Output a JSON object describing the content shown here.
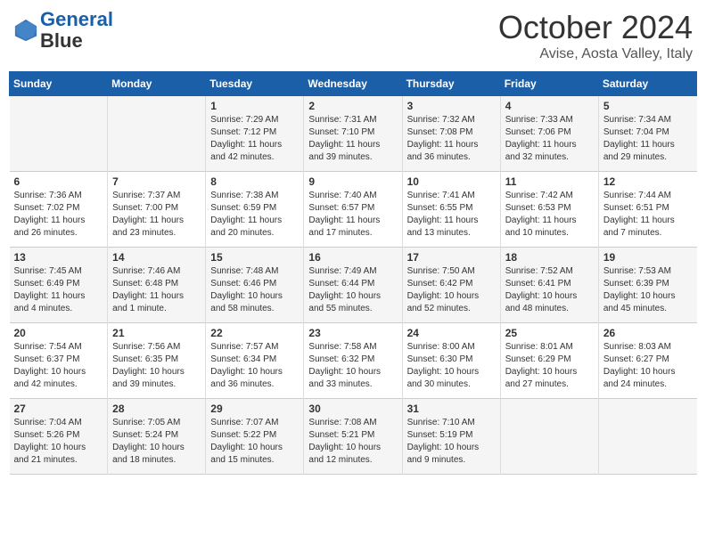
{
  "header": {
    "logo_line1": "General",
    "logo_line2": "Blue",
    "title": "October 2024",
    "subtitle": "Avise, Aosta Valley, Italy"
  },
  "days_of_week": [
    "Sunday",
    "Monday",
    "Tuesday",
    "Wednesday",
    "Thursday",
    "Friday",
    "Saturday"
  ],
  "weeks": [
    [
      {
        "day": "",
        "info": ""
      },
      {
        "day": "",
        "info": ""
      },
      {
        "day": "1",
        "info": "Sunrise: 7:29 AM\nSunset: 7:12 PM\nDaylight: 11 hours\nand 42 minutes."
      },
      {
        "day": "2",
        "info": "Sunrise: 7:31 AM\nSunset: 7:10 PM\nDaylight: 11 hours\nand 39 minutes."
      },
      {
        "day": "3",
        "info": "Sunrise: 7:32 AM\nSunset: 7:08 PM\nDaylight: 11 hours\nand 36 minutes."
      },
      {
        "day": "4",
        "info": "Sunrise: 7:33 AM\nSunset: 7:06 PM\nDaylight: 11 hours\nand 32 minutes."
      },
      {
        "day": "5",
        "info": "Sunrise: 7:34 AM\nSunset: 7:04 PM\nDaylight: 11 hours\nand 29 minutes."
      }
    ],
    [
      {
        "day": "6",
        "info": "Sunrise: 7:36 AM\nSunset: 7:02 PM\nDaylight: 11 hours\nand 26 minutes."
      },
      {
        "day": "7",
        "info": "Sunrise: 7:37 AM\nSunset: 7:00 PM\nDaylight: 11 hours\nand 23 minutes."
      },
      {
        "day": "8",
        "info": "Sunrise: 7:38 AM\nSunset: 6:59 PM\nDaylight: 11 hours\nand 20 minutes."
      },
      {
        "day": "9",
        "info": "Sunrise: 7:40 AM\nSunset: 6:57 PM\nDaylight: 11 hours\nand 17 minutes."
      },
      {
        "day": "10",
        "info": "Sunrise: 7:41 AM\nSunset: 6:55 PM\nDaylight: 11 hours\nand 13 minutes."
      },
      {
        "day": "11",
        "info": "Sunrise: 7:42 AM\nSunset: 6:53 PM\nDaylight: 11 hours\nand 10 minutes."
      },
      {
        "day": "12",
        "info": "Sunrise: 7:44 AM\nSunset: 6:51 PM\nDaylight: 11 hours\nand 7 minutes."
      }
    ],
    [
      {
        "day": "13",
        "info": "Sunrise: 7:45 AM\nSunset: 6:49 PM\nDaylight: 11 hours\nand 4 minutes."
      },
      {
        "day": "14",
        "info": "Sunrise: 7:46 AM\nSunset: 6:48 PM\nDaylight: 11 hours\nand 1 minute."
      },
      {
        "day": "15",
        "info": "Sunrise: 7:48 AM\nSunset: 6:46 PM\nDaylight: 10 hours\nand 58 minutes."
      },
      {
        "day": "16",
        "info": "Sunrise: 7:49 AM\nSunset: 6:44 PM\nDaylight: 10 hours\nand 55 minutes."
      },
      {
        "day": "17",
        "info": "Sunrise: 7:50 AM\nSunset: 6:42 PM\nDaylight: 10 hours\nand 52 minutes."
      },
      {
        "day": "18",
        "info": "Sunrise: 7:52 AM\nSunset: 6:41 PM\nDaylight: 10 hours\nand 48 minutes."
      },
      {
        "day": "19",
        "info": "Sunrise: 7:53 AM\nSunset: 6:39 PM\nDaylight: 10 hours\nand 45 minutes."
      }
    ],
    [
      {
        "day": "20",
        "info": "Sunrise: 7:54 AM\nSunset: 6:37 PM\nDaylight: 10 hours\nand 42 minutes."
      },
      {
        "day": "21",
        "info": "Sunrise: 7:56 AM\nSunset: 6:35 PM\nDaylight: 10 hours\nand 39 minutes."
      },
      {
        "day": "22",
        "info": "Sunrise: 7:57 AM\nSunset: 6:34 PM\nDaylight: 10 hours\nand 36 minutes."
      },
      {
        "day": "23",
        "info": "Sunrise: 7:58 AM\nSunset: 6:32 PM\nDaylight: 10 hours\nand 33 minutes."
      },
      {
        "day": "24",
        "info": "Sunrise: 8:00 AM\nSunset: 6:30 PM\nDaylight: 10 hours\nand 30 minutes."
      },
      {
        "day": "25",
        "info": "Sunrise: 8:01 AM\nSunset: 6:29 PM\nDaylight: 10 hours\nand 27 minutes."
      },
      {
        "day": "26",
        "info": "Sunrise: 8:03 AM\nSunset: 6:27 PM\nDaylight: 10 hours\nand 24 minutes."
      }
    ],
    [
      {
        "day": "27",
        "info": "Sunrise: 7:04 AM\nSunset: 5:26 PM\nDaylight: 10 hours\nand 21 minutes."
      },
      {
        "day": "28",
        "info": "Sunrise: 7:05 AM\nSunset: 5:24 PM\nDaylight: 10 hours\nand 18 minutes."
      },
      {
        "day": "29",
        "info": "Sunrise: 7:07 AM\nSunset: 5:22 PM\nDaylight: 10 hours\nand 15 minutes."
      },
      {
        "day": "30",
        "info": "Sunrise: 7:08 AM\nSunset: 5:21 PM\nDaylight: 10 hours\nand 12 minutes."
      },
      {
        "day": "31",
        "info": "Sunrise: 7:10 AM\nSunset: 5:19 PM\nDaylight: 10 hours\nand 9 minutes."
      },
      {
        "day": "",
        "info": ""
      },
      {
        "day": "",
        "info": ""
      }
    ]
  ]
}
